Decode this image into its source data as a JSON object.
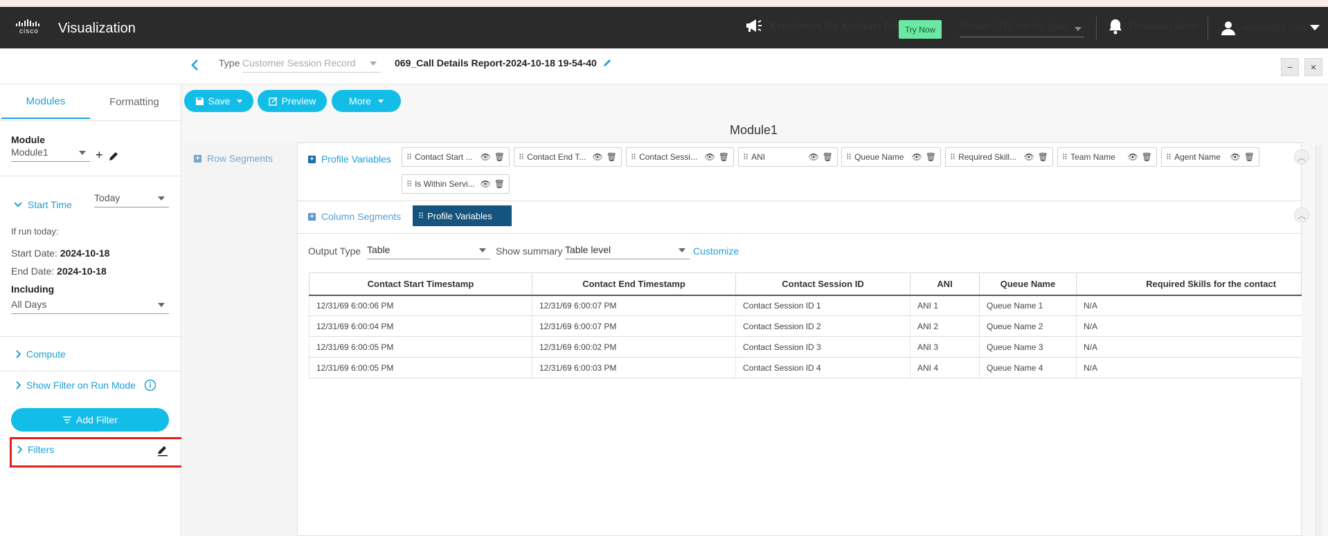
{
  "header": {
    "app_title": "Visualization",
    "logo_text": "cisco",
    "beta_text": "Experience the Analyzer Beta",
    "try_now": "Try Now",
    "tenant": "Tenant (UTC-04:00) East",
    "threshold_alerts": "Threshold Alerts",
    "user": "Admin069 Lab"
  },
  "report_bar": {
    "type_label": "Type",
    "type_value": "Customer Session Record",
    "report_name": "069_Call Details Report-2024-10-18 19-54-40",
    "minimize": "−",
    "close": "×"
  },
  "left_panel": {
    "tabs": [
      "Modules",
      "Formatting"
    ],
    "module_label": "Module",
    "module_value": "Module1",
    "start_time_label": "Start Time",
    "start_time_value": "Today",
    "if_run_today": "If run today:",
    "start_date_label": "Start Date:",
    "start_date_value": "2024-10-18",
    "end_date_label": "End Date:",
    "end_date_value": "2024-10-18",
    "including_label": "Including",
    "including_value": "All Days",
    "compute": "Compute",
    "show_filter": "Show Filter on Run Mode",
    "add_filter": "Add Filter",
    "filters": "Filters"
  },
  "toolbar": {
    "save": "Save",
    "preview": "Preview",
    "more": "More"
  },
  "module_title": "Module1",
  "segments": {
    "row_segments": "Row Segments",
    "profile_variables": "Profile Variables",
    "column_segments": "Column Segments",
    "column_chip": "Profile Variables",
    "chips": [
      "Contact Start ...",
      "Contact End T...",
      "Contact Sessi...",
      "ANI",
      "Queue Name",
      "Required Skill...",
      "Team Name",
      "Agent Name",
      "Is Within Servi..."
    ]
  },
  "output": {
    "output_type_label": "Output Type",
    "output_type_value": "Table",
    "show_summary_label": "Show summary",
    "show_summary_value": "Table level",
    "customize": "Customize"
  },
  "table": {
    "headers": [
      "Contact Start Timestamp",
      "Contact End Timestamp",
      "Contact Session ID",
      "ANI",
      "Queue Name",
      "Required Skills for the contact"
    ],
    "rows": [
      [
        "12/31/69 6:00:06 PM",
        "12/31/69 6:00:07 PM",
        "Contact Session ID 1",
        "ANI 1",
        "Queue Name 1",
        "N/A"
      ],
      [
        "12/31/69 6:00:04 PM",
        "12/31/69 6:00:07 PM",
        "Contact Session ID 2",
        "ANI 2",
        "Queue Name 2",
        "N/A"
      ],
      [
        "12/31/69 6:00:05 PM",
        "12/31/69 6:00:02 PM",
        "Contact Session ID 3",
        "ANI 3",
        "Queue Name 3",
        "N/A"
      ],
      [
        "12/31/69 6:00:05 PM",
        "12/31/69 6:00:03 PM",
        "Contact Session ID 4",
        "ANI 4",
        "Queue Name 4",
        "N/A"
      ]
    ]
  },
  "colors": {
    "accent": "#1ca0d8",
    "button": "#12bde8",
    "dark_chip": "#15547e",
    "topbar": "#2b2b2b",
    "highlight": "#e32020"
  }
}
